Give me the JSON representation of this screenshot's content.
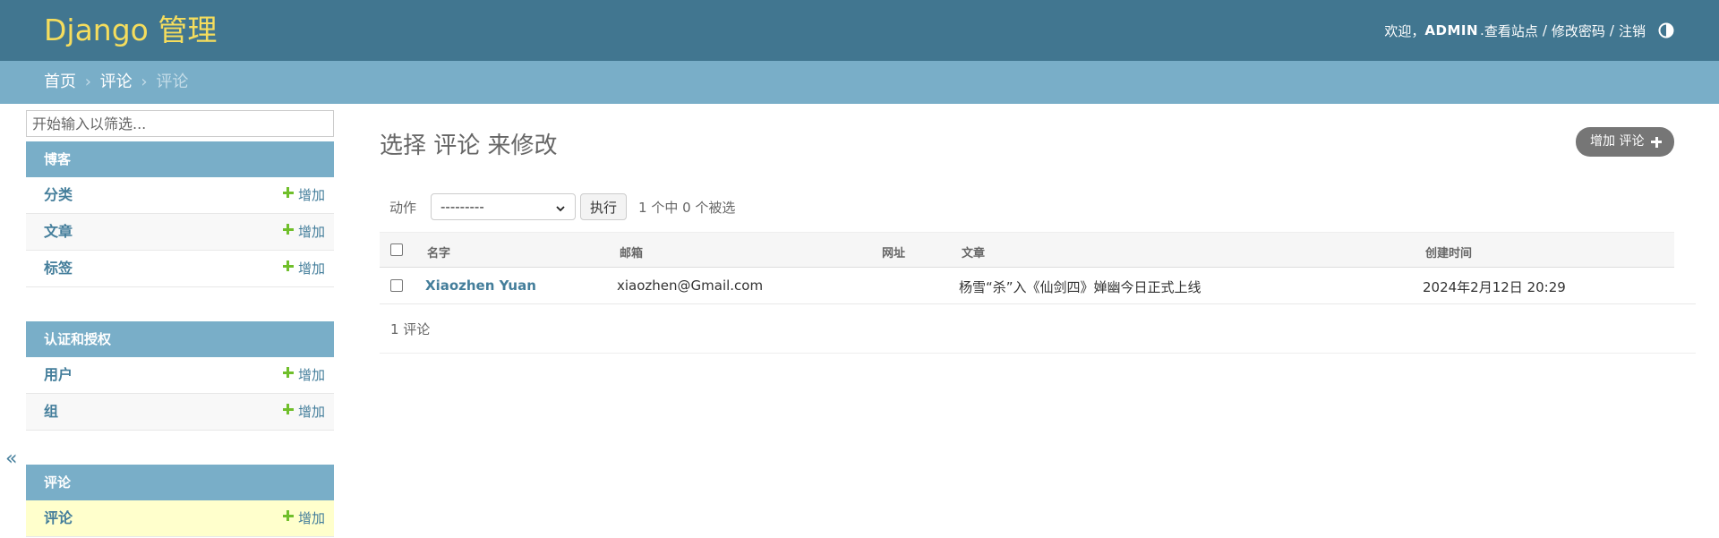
{
  "header": {
    "brand": "Django 管理",
    "welcome": "欢迎，",
    "username": "ADMIN",
    "view_site": "查看站点",
    "change_password": "修改密码",
    "logout": "注销",
    "sep": "/"
  },
  "breadcrumbs": {
    "home": "首页",
    "app": "评论",
    "current": "评论",
    "sep": "›"
  },
  "sidebar": {
    "filter_placeholder": "开始输入以筛选...",
    "toggle": "«",
    "add_label": "增加",
    "modules": [
      {
        "caption": "博客",
        "items": [
          "分类",
          "文章",
          "标签"
        ]
      },
      {
        "caption": "认证和授权",
        "items": [
          "用户",
          "组"
        ]
      },
      {
        "caption": "评论",
        "items": [
          "评论"
        ]
      }
    ]
  },
  "content": {
    "title": "选择 评论 来修改",
    "add_button": "增加 评论",
    "actions": {
      "label": "动作",
      "selected_option": "---------",
      "go_button": "执行",
      "counter": "1 个中 0 个被选"
    },
    "table": {
      "headers": [
        "名字",
        "邮箱",
        "网址",
        "文章",
        "创建时间"
      ],
      "rows": [
        {
          "name": "Xiaozhen Yuan",
          "email": "xiaozhen@Gmail.com",
          "url": "",
          "article": "杨雪“杀”入《仙剑四》婵幽今日正式上线",
          "created": "2024年2月12日 20:29"
        }
      ]
    },
    "paginator": "1 评论"
  },
  "colors": {
    "header_bg": "#417690",
    "breadcrumb_bg": "#79aec8",
    "brand": "#f5dd5d",
    "link": "#447e9b",
    "add_green": "#70bf2b",
    "current_row": "#ffffcc"
  }
}
